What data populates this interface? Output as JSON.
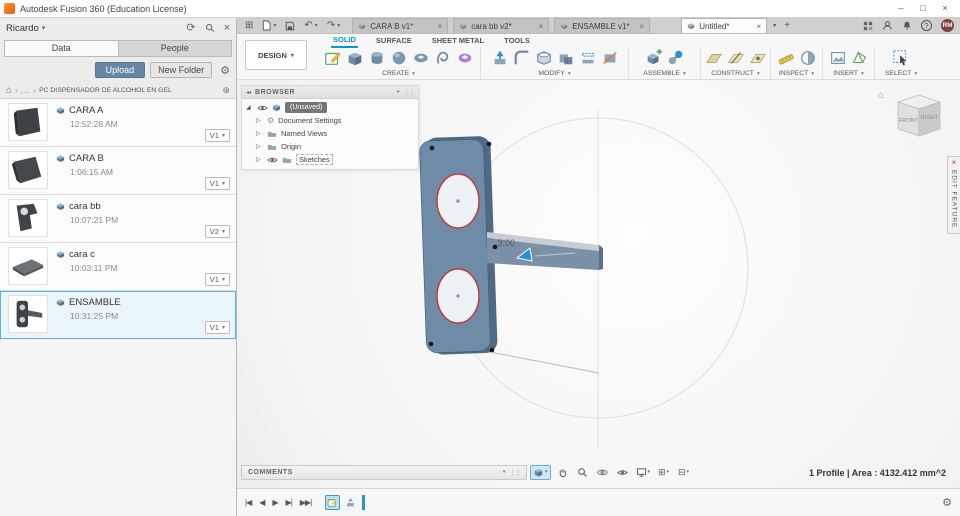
{
  "icons": {
    "chevron_down": "▾",
    "tree_collapsed": "▷",
    "tree_expanded": "◢",
    "close": "×",
    "minimize": "–",
    "maximize": "□",
    "home": "⌂",
    "refresh": "⟳",
    "share": "⊕",
    "gear": "⚙",
    "plus": "+",
    "app_grid": "⊞",
    "undo": "↶",
    "redo": "↷",
    "ellipsis": "...",
    "crumb_sep": "›",
    "collapse_left": "◂◂",
    "help": "?",
    "dot": "●",
    "grip": "⋮⋮",
    "grid_display": "⊞",
    "viewports": "⊟",
    "timeline_controls": [
      "|◀",
      "◀",
      "▶",
      "▶|",
      "▶▶|"
    ]
  },
  "titlebar": {
    "title": "Autodesk Fusion 360 (Education License)"
  },
  "data_panel": {
    "user": "Ricardo",
    "tab_data": "Data",
    "tab_people": "People",
    "upload": "Upload",
    "new_folder": "New Folder",
    "project": "PC DISPENSADOR DE ALCOHOL EN GEL",
    "items": [
      {
        "name": "CARA A",
        "time": "12:52:28 AM",
        "version": "V1"
      },
      {
        "name": "CARA B",
        "time": "1:06:15 AM",
        "version": "V1"
      },
      {
        "name": "cara bb",
        "time": "10:07:21 PM",
        "version": "V2"
      },
      {
        "name": "cara c",
        "time": "10:03:11 PM",
        "version": "V1"
      },
      {
        "name": "ENSAMBLE",
        "time": "10:31:25 PM",
        "version": "V1"
      }
    ]
  },
  "doc_tabs": {
    "tabs": [
      {
        "label": "CARA B v1*"
      },
      {
        "label": "cara bb v2*"
      },
      {
        "label": "ENSAMBLE v1*"
      },
      {
        "label": "Untitled*"
      }
    ],
    "avatar": "RM"
  },
  "ribbon": {
    "design": "DESIGN",
    "tabs": [
      "SOLID",
      "SURFACE",
      "SHEET METAL",
      "TOOLS"
    ],
    "groups": [
      "CREATE",
      "MODIFY",
      "ASSEMBLE",
      "CONSTRUCT",
      "INSPECT",
      "INSERT",
      "SELECT"
    ]
  },
  "browser": {
    "title": "BROWSER",
    "root": "(Unsaved)",
    "nodes": [
      "Document Settings",
      "Named Views",
      "Origin",
      "Sketches"
    ]
  },
  "viewcube": {
    "front": "FRONT",
    "right": "RIGHT"
  },
  "edit_feature": "EDIT FEATURE",
  "scene": {
    "dimension": "3.00"
  },
  "comments": {
    "title": "COMMENTS"
  },
  "status_bar": {
    "selection_info": "1 Profile | Area : 4132.412 mm^2"
  }
}
